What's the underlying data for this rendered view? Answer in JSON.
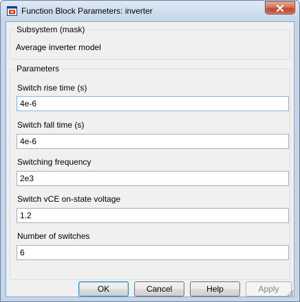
{
  "window": {
    "title": "Function Block Parameters: inverter"
  },
  "mask": {
    "type_label": "Subsystem (mask)",
    "description": "Average inverter model"
  },
  "parameters": {
    "group_title": "Parameters",
    "fields": [
      {
        "label": "Switch rise time (s)",
        "value": "4e-6"
      },
      {
        "label": "Switch fall time (s)",
        "value": "4e-6"
      },
      {
        "label": "Switching frequency",
        "value": "2e3"
      },
      {
        "label": "Switch vCE on-state voltage",
        "value": "1.2"
      },
      {
        "label": "Number of switches",
        "value": "6"
      }
    ]
  },
  "buttons": {
    "ok": "OK",
    "cancel": "Cancel",
    "help": "Help",
    "apply": "Apply"
  },
  "icons": {
    "app": "simulink-block-icon",
    "close": "close-icon",
    "resize": "resize-grip-icon"
  },
  "colors": {
    "frame": "#c4d6ea",
    "close_button": "#c1492f",
    "focus_border": "#7eb4ea"
  }
}
